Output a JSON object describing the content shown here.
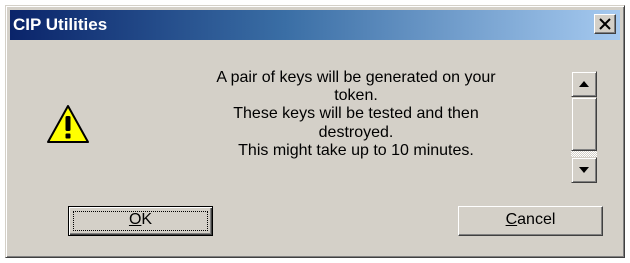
{
  "window": {
    "title": "CIP Utilities",
    "close_icon": "close-icon"
  },
  "message": {
    "icon": "warning-icon",
    "lines": [
      "A pair of keys will be generated on your",
      "token.",
      "These keys will be tested and then",
      "destroyed.",
      "This might take up to 10 minutes."
    ]
  },
  "scrollbar": {
    "up_icon": "arrow-up-icon",
    "down_icon": "arrow-down-icon"
  },
  "buttons": {
    "ok": {
      "mnemonic": "O",
      "rest": "K"
    },
    "cancel": {
      "mnemonic": "C",
      "rest": "ancel"
    }
  },
  "colors": {
    "title_bar_start": "#0a246a",
    "title_bar_end": "#a6caf0",
    "dialog_face": "#d4d0c8",
    "warning_yellow": "#ffff00"
  }
}
